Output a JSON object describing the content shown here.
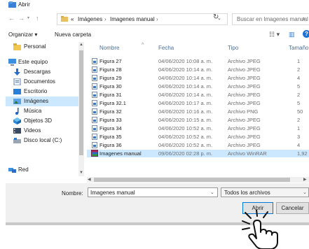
{
  "window": {
    "title": "Abrir"
  },
  "nav": {
    "back_icon": "back-arrow-icon",
    "forward_icon": "forward-arrow-icon",
    "up_icon": "up-arrow-icon",
    "breadcrumb": [
      "«",
      "Imágenes",
      "Imagenes manual"
    ],
    "search_placeholder": "Buscar en Imagenes manual"
  },
  "toolbar": {
    "organize_label": "Organizar ▾",
    "new_folder_label": "Nueva carpeta"
  },
  "sidebar": {
    "items": [
      {
        "label": "Personal",
        "icon": "folder-icon"
      },
      {
        "label": "Este equipo",
        "icon": "computer-icon"
      },
      {
        "label": "Descargas",
        "icon": "download-icon"
      },
      {
        "label": "Documentos",
        "icon": "documents-icon"
      },
      {
        "label": "Escritorio",
        "icon": "desktop-icon"
      },
      {
        "label": "Imágenes",
        "icon": "pictures-icon",
        "selected": true
      },
      {
        "label": "Música",
        "icon": "music-icon"
      },
      {
        "label": "Objetos 3D",
        "icon": "objects3d-icon"
      },
      {
        "label": "Videos",
        "icon": "videos-icon"
      },
      {
        "label": "Disco local (C:)",
        "icon": "drive-icon"
      },
      {
        "label": "Red",
        "icon": "network-icon"
      }
    ]
  },
  "list": {
    "columns": [
      "Nombre",
      "Fecha",
      "Tipo",
      "Tamaño"
    ],
    "rows": [
      {
        "name": "Figura 27",
        "date": "04/06/2020 10:08 a. m.",
        "type": "Archivo JPEG",
        "size": "1"
      },
      {
        "name": "Figura 28",
        "date": "04/06/2020 10:14 a. m.",
        "type": "Archivo JPEG",
        "size": "2"
      },
      {
        "name": "Figura 29",
        "date": "04/06/2020 10:14 a. m.",
        "type": "Archivo JPEG",
        "size": "4"
      },
      {
        "name": "Figura 30",
        "date": "04/06/2020 10:14 a. m.",
        "type": "Archivo JPEG",
        "size": "5"
      },
      {
        "name": "Figura 31",
        "date": "04/06/2020 10:14 a. m.",
        "type": "Archivo JPEG",
        "size": "2"
      },
      {
        "name": "Figura 32.1",
        "date": "04/06/2020 10:17 a. m.",
        "type": "Archivo JPEG",
        "size": "5"
      },
      {
        "name": "Figura 32",
        "date": "04/06/2020 10:16 a. m.",
        "type": "Archivo PNG",
        "size": "50"
      },
      {
        "name": "Figura 33",
        "date": "04/06/2020 10:15 a. m.",
        "type": "Archivo JPEG",
        "size": "2"
      },
      {
        "name": "Figura 34",
        "date": "04/06/2020 10:52 a. m.",
        "type": "Archivo JPEG",
        "size": "1"
      },
      {
        "name": "Figura 35",
        "date": "04/06/2020 10:52 a. m.",
        "type": "Archivo JPEG",
        "size": "3"
      },
      {
        "name": "Figura 36",
        "date": "04/06/2020 10:52 a. m.",
        "type": "Archivo JPEG",
        "size": "4"
      },
      {
        "name": "Imagenes manual",
        "date": "09/06/2020 02:28 p. m.",
        "type": "Archivo WinRAR",
        "size": "1,92",
        "selected": true,
        "icon": "winrar-archive-icon"
      }
    ]
  },
  "bottom": {
    "name_label": "Nombre:",
    "name_value": "Imagenes manual",
    "filetype_value": "Todos los archivos",
    "open_label": "Abrir",
    "cancel_label": "Cancelar"
  },
  "colors": {
    "selection": "#cce8ff",
    "accent": "#0078d7"
  }
}
